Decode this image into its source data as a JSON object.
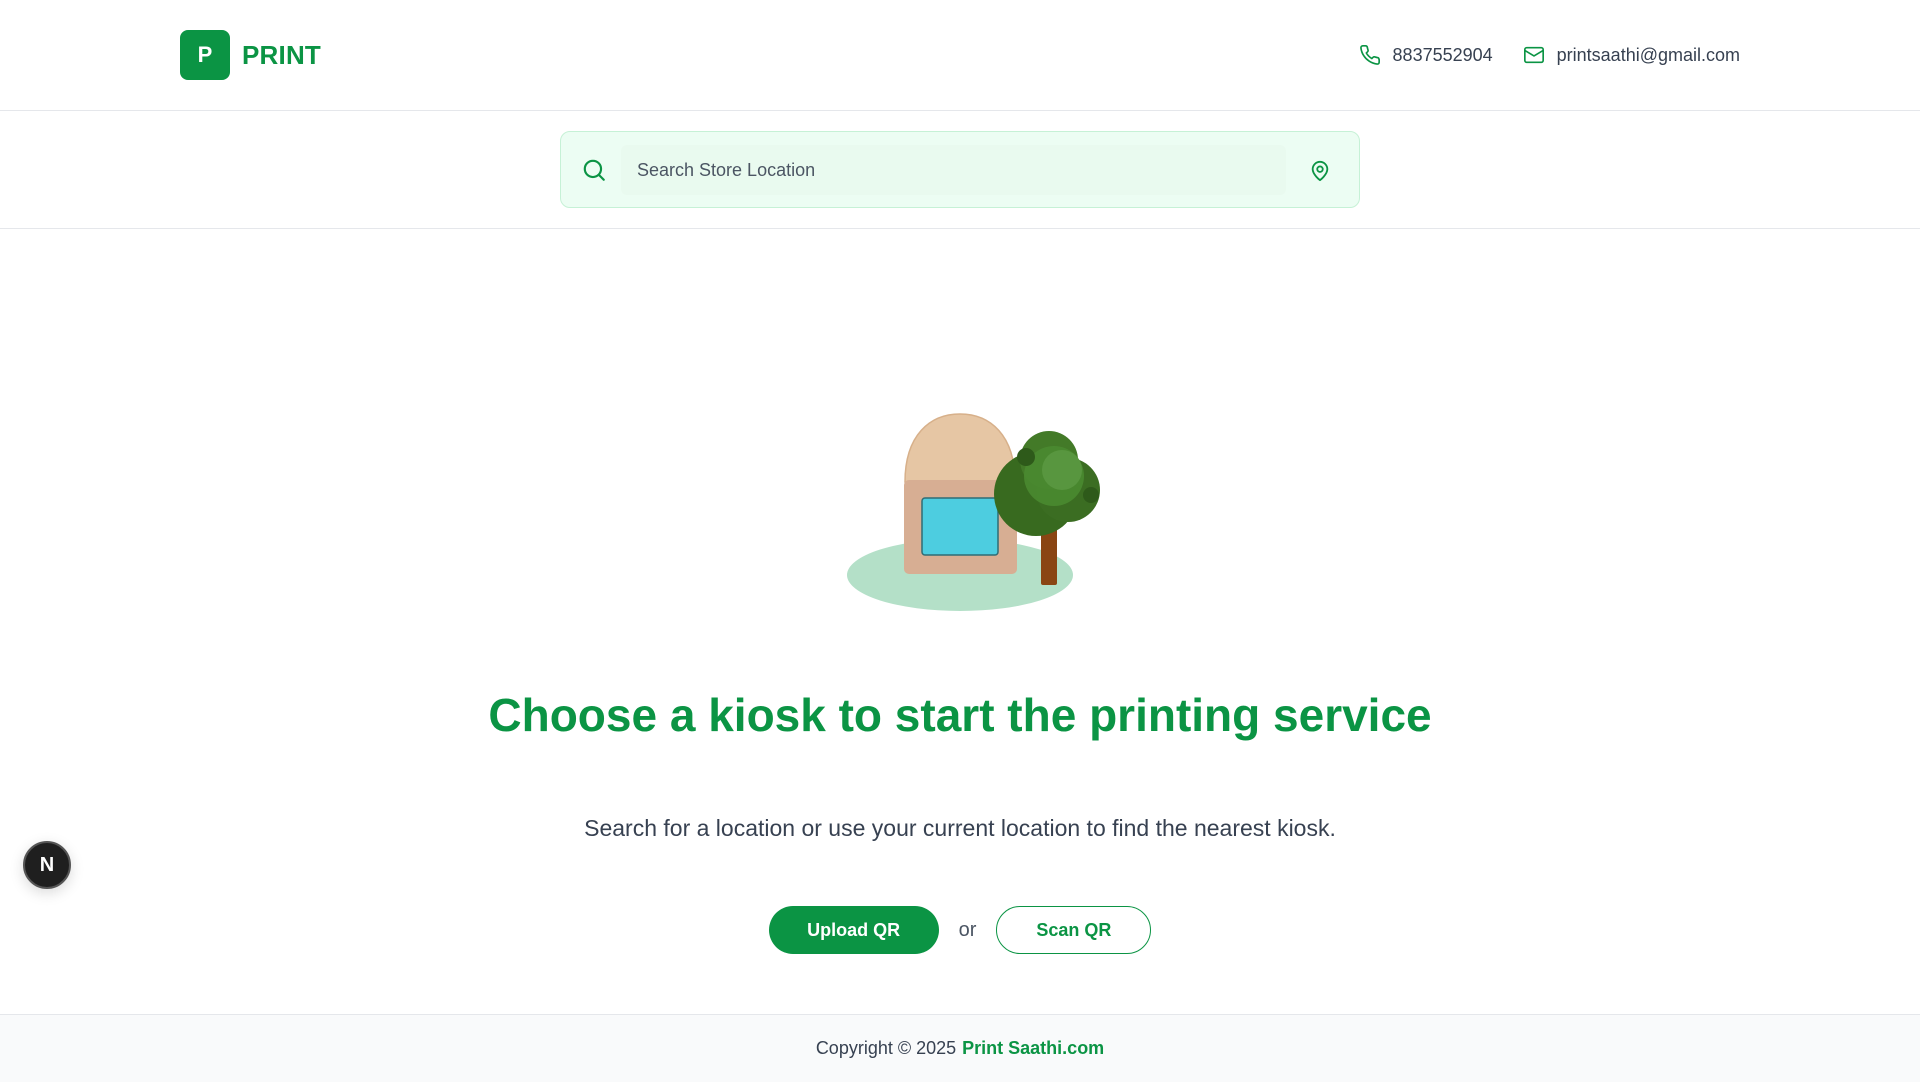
{
  "colors": {
    "brand": "#0b9444",
    "search_bg": "#ecfdf3"
  },
  "header": {
    "logo_letter": "P",
    "brand": "PRINT",
    "phone": "8837552904",
    "email": "printsaathi@gmail.com",
    "phone_icon": "phone-icon",
    "email_icon": "mail-icon"
  },
  "search": {
    "placeholder": "Search Store Location",
    "value": "",
    "search_icon": "search-icon",
    "location_icon": "map-pin-icon"
  },
  "main": {
    "headline": "Choose a kiosk to start the printing service",
    "subline": "Search for a location or use your current location to find the nearest kiosk.",
    "upload_label": "Upload QR",
    "or_label": "or",
    "scan_label": "Scan QR"
  },
  "badge": {
    "letter": "N"
  },
  "footer": {
    "copyright": "Copyright © 2025",
    "link": "Print Saathi.com"
  }
}
